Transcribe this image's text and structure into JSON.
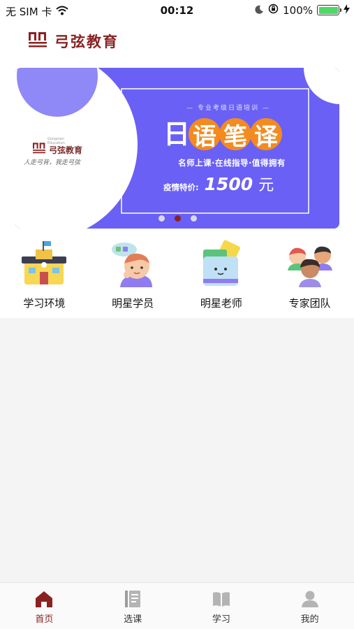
{
  "status_bar": {
    "carrier": "无 SIM 卡",
    "time": "00:12",
    "battery": "100%"
  },
  "header": {
    "brand_name": "弓弦教育"
  },
  "banner": {
    "logo_text": "弓弦教育",
    "logo_sub": "Gongxian Education",
    "slogan": "人走弓背，我走弓弦",
    "subtitle": "— 专业考级日语培训 —",
    "title_chars": [
      "日",
      "语",
      "笔",
      "译"
    ],
    "features": "名师上课·在线指导·值得拥有",
    "price_label": "疫情特价:",
    "price_value": "1500",
    "price_unit": "元",
    "page_count": 3,
    "active_page": 2,
    "colors": {
      "background": "#6a60f5",
      "accent": "#f38b1e",
      "brand": "#8b2222"
    }
  },
  "quick_nav": [
    {
      "label": "学习环境",
      "icon": "school-building-icon"
    },
    {
      "label": "明星学员",
      "icon": "student-avatar-icon"
    },
    {
      "label": "明星老师",
      "icon": "teacher-book-icon"
    },
    {
      "label": "专家团队",
      "icon": "team-group-icon"
    }
  ],
  "tab_bar": [
    {
      "label": "首页",
      "icon": "home-icon",
      "active": true
    },
    {
      "label": "选课",
      "icon": "course-list-icon",
      "active": false
    },
    {
      "label": "学习",
      "icon": "open-book-icon",
      "active": false
    },
    {
      "label": "我的",
      "icon": "user-icon",
      "active": false
    }
  ]
}
